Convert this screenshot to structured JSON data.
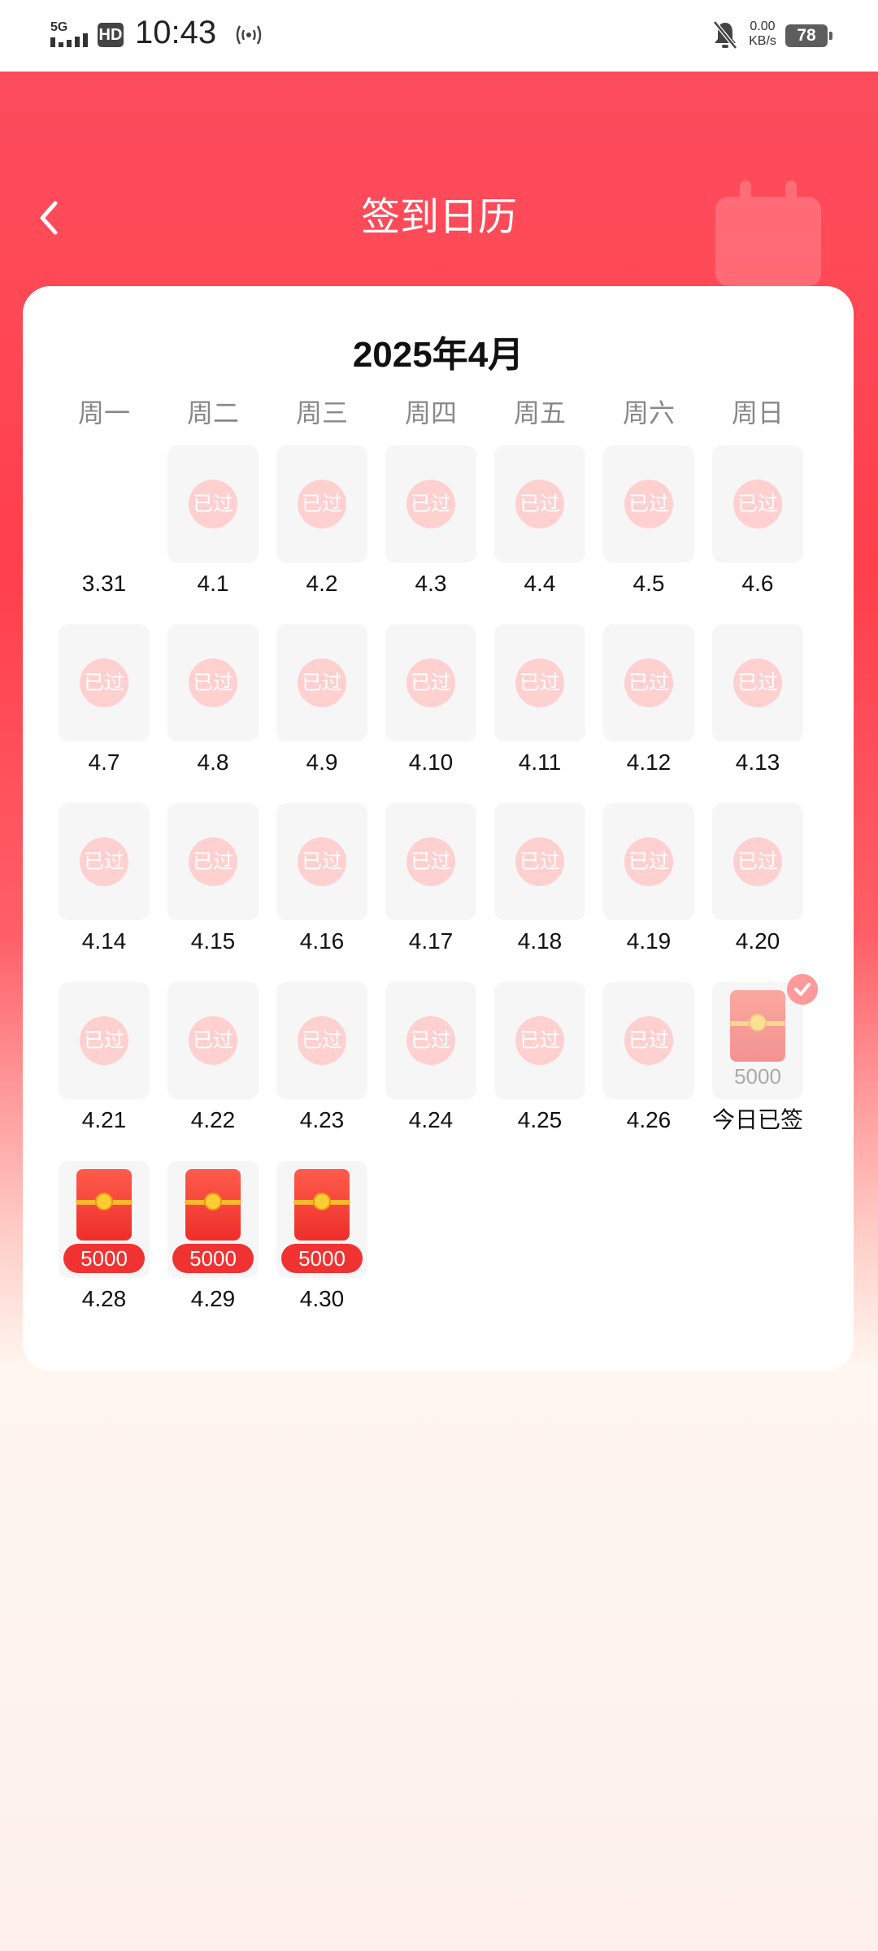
{
  "status_bar": {
    "network": "5G",
    "hd": "HD",
    "time": "10:43",
    "speed_value": "0.00",
    "speed_unit": "KB/s",
    "battery": "78"
  },
  "header": {
    "title": "签到日历"
  },
  "calendar": {
    "month_title": "2025年4月",
    "weekdays": [
      "周一",
      "周二",
      "周三",
      "周四",
      "周五",
      "周六",
      "周日"
    ],
    "past_label": "已过",
    "days": [
      {
        "label": "3.31",
        "state": "empty"
      },
      {
        "label": "4.1",
        "state": "past"
      },
      {
        "label": "4.2",
        "state": "past"
      },
      {
        "label": "4.3",
        "state": "past"
      },
      {
        "label": "4.4",
        "state": "past"
      },
      {
        "label": "4.5",
        "state": "past"
      },
      {
        "label": "4.6",
        "state": "past"
      },
      {
        "label": "4.7",
        "state": "past"
      },
      {
        "label": "4.8",
        "state": "past"
      },
      {
        "label": "4.9",
        "state": "past"
      },
      {
        "label": "4.10",
        "state": "past"
      },
      {
        "label": "4.11",
        "state": "past"
      },
      {
        "label": "4.12",
        "state": "past"
      },
      {
        "label": "4.13",
        "state": "past"
      },
      {
        "label": "4.14",
        "state": "past"
      },
      {
        "label": "4.15",
        "state": "past"
      },
      {
        "label": "4.16",
        "state": "past"
      },
      {
        "label": "4.17",
        "state": "past"
      },
      {
        "label": "4.18",
        "state": "past"
      },
      {
        "label": "4.19",
        "state": "past"
      },
      {
        "label": "4.20",
        "state": "past"
      },
      {
        "label": "4.21",
        "state": "past"
      },
      {
        "label": "4.22",
        "state": "past"
      },
      {
        "label": "4.23",
        "state": "past"
      },
      {
        "label": "4.24",
        "state": "past"
      },
      {
        "label": "4.25",
        "state": "past"
      },
      {
        "label": "4.26",
        "state": "past"
      },
      {
        "label": "今日已签",
        "state": "today",
        "amount": "5000"
      },
      {
        "label": "4.28",
        "state": "future",
        "amount": "5000"
      },
      {
        "label": "4.29",
        "state": "future",
        "amount": "5000"
      },
      {
        "label": "4.30",
        "state": "future",
        "amount": "5000"
      }
    ]
  },
  "colors": {
    "brand_red": "#ff4a58",
    "envelope_red": "#f03232",
    "past_badge": "#ffd0d0"
  }
}
